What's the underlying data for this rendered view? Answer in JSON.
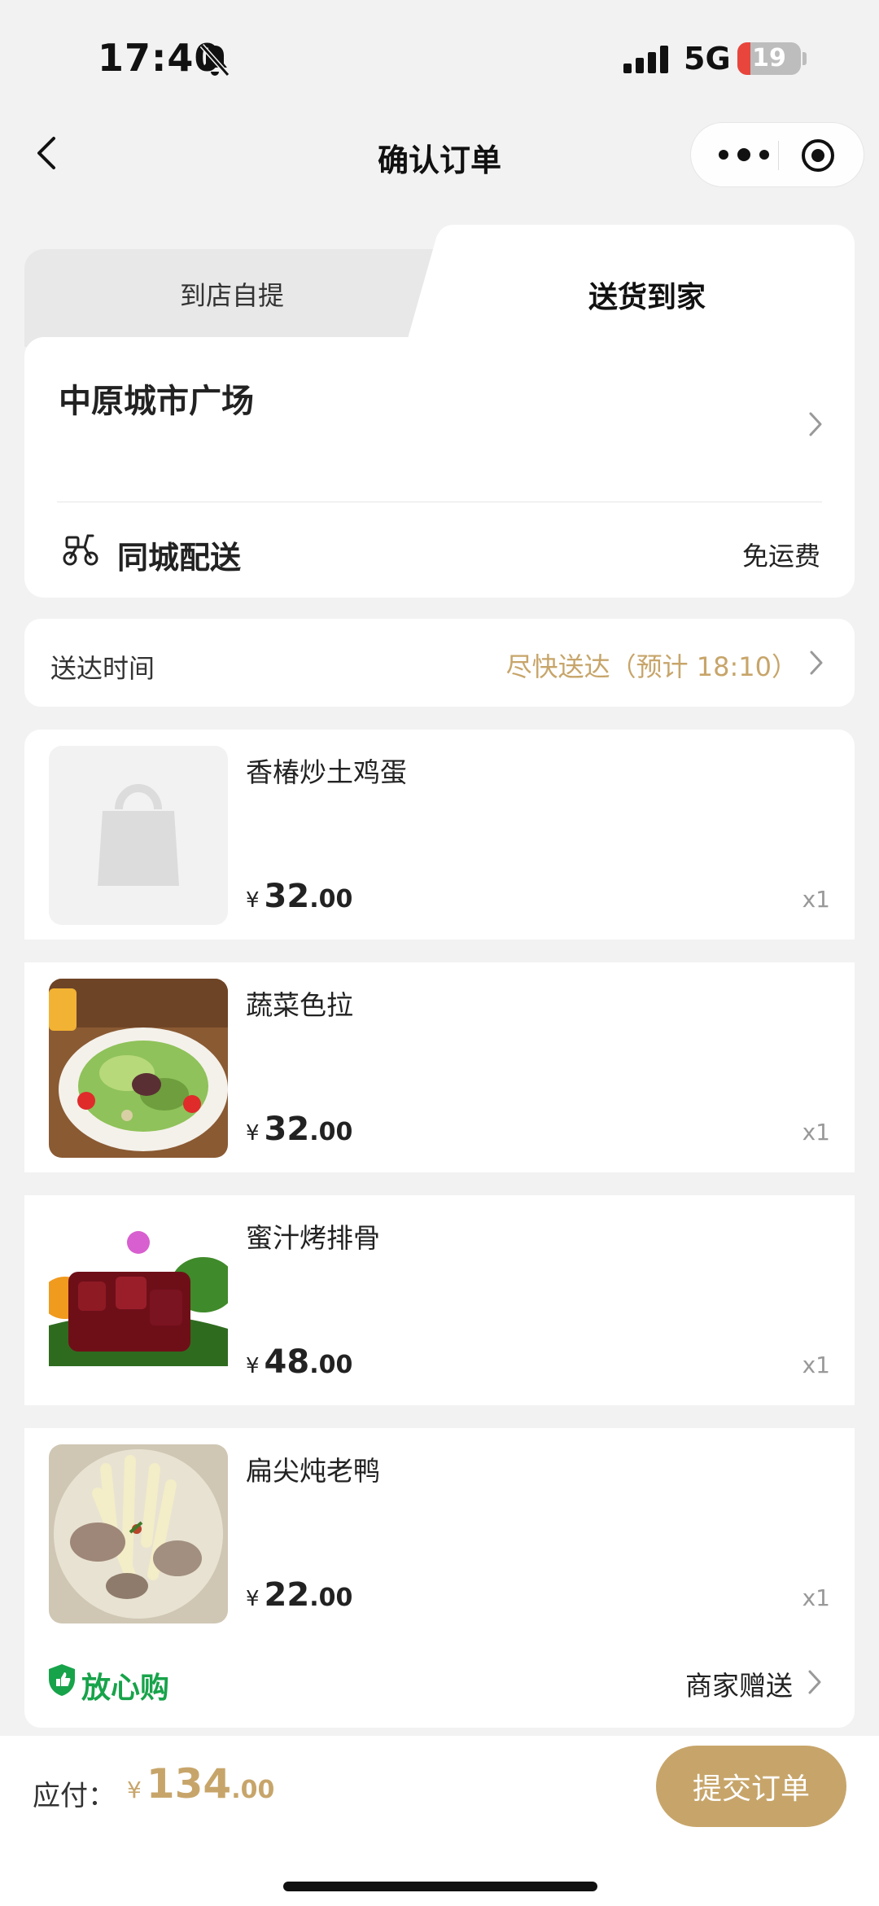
{
  "status_bar": {
    "time": "17:40",
    "network": "5G",
    "battery": "19"
  },
  "nav": {
    "title": "确认订单"
  },
  "delivery": {
    "tabs": [
      {
        "label": "到店自提",
        "active": false
      },
      {
        "label": "送货到家",
        "active": true
      }
    ],
    "address": "中原城市广场",
    "shipping_label": "同城配送",
    "shipping_fee": "免运费"
  },
  "delivery_time": {
    "label": "送达时间",
    "value": "尽快送达（预计 18:10）"
  },
  "items": [
    {
      "name": "香椿炒土鸡蛋",
      "currency": "¥",
      "price_int": "32",
      "price_dec": ".00",
      "qty": "x1",
      "image": "placeholder-bag"
    },
    {
      "name": "蔬菜色拉",
      "currency": "¥",
      "price_int": "32",
      "price_dec": ".00",
      "qty": "x1",
      "image": "salad"
    },
    {
      "name": "蜜汁烤排骨",
      "currency": "¥",
      "price_int": "48",
      "price_dec": ".00",
      "qty": "x1",
      "image": "ribs"
    },
    {
      "name": "扁尖炖老鸭",
      "currency": "¥",
      "price_int": "22",
      "price_dec": ".00",
      "qty": "x1",
      "image": "duck-soup"
    }
  ],
  "assurance": {
    "label": "放心购",
    "gift_label": "商家赠送"
  },
  "footer": {
    "pay_label": "应付：",
    "currency": "¥",
    "total_int": "134",
    "total_dec": ".00",
    "submit_label": "提交订单"
  },
  "colors": {
    "accent": "#c7a56a",
    "assurance_green": "#17a34a",
    "background": "#f2f2f2"
  }
}
